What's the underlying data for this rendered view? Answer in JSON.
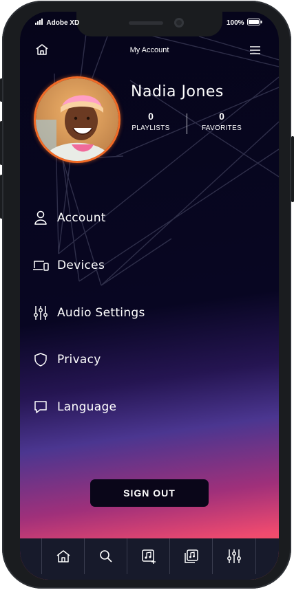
{
  "status_bar": {
    "carrier": "Adobe XD",
    "battery": "100%"
  },
  "header": {
    "title": "My Account",
    "home_icon": "home-icon",
    "menu_icon": "menu-icon"
  },
  "profile": {
    "name": "Nadia Jones",
    "playlists_count": "0",
    "playlists_label": "PLAYLISTS",
    "favorites_count": "0",
    "favorites_label": "FAVORITES"
  },
  "menu": {
    "items": [
      {
        "label": "Account",
        "icon": "user-icon"
      },
      {
        "label": "Devices",
        "icon": "devices-icon"
      },
      {
        "label": "Audio Settings",
        "icon": "equalizer-icon"
      },
      {
        "label": "Privacy",
        "icon": "shield-icon"
      },
      {
        "label": "Language",
        "icon": "chat-icon"
      }
    ]
  },
  "sign_out": {
    "label": "SIGN OUT"
  },
  "tab_bar": {
    "tabs": [
      {
        "icon": "home-icon"
      },
      {
        "icon": "search-icon"
      },
      {
        "icon": "add-music-icon"
      },
      {
        "icon": "library-icon"
      },
      {
        "icon": "equalizer-icon"
      }
    ]
  },
  "colors": {
    "accent_ring": "#f26a25",
    "background": "#06051a",
    "gradient_purple": "#4b3690",
    "gradient_pink": "#ef4a6f",
    "gradient_orange": "#f7664c"
  }
}
